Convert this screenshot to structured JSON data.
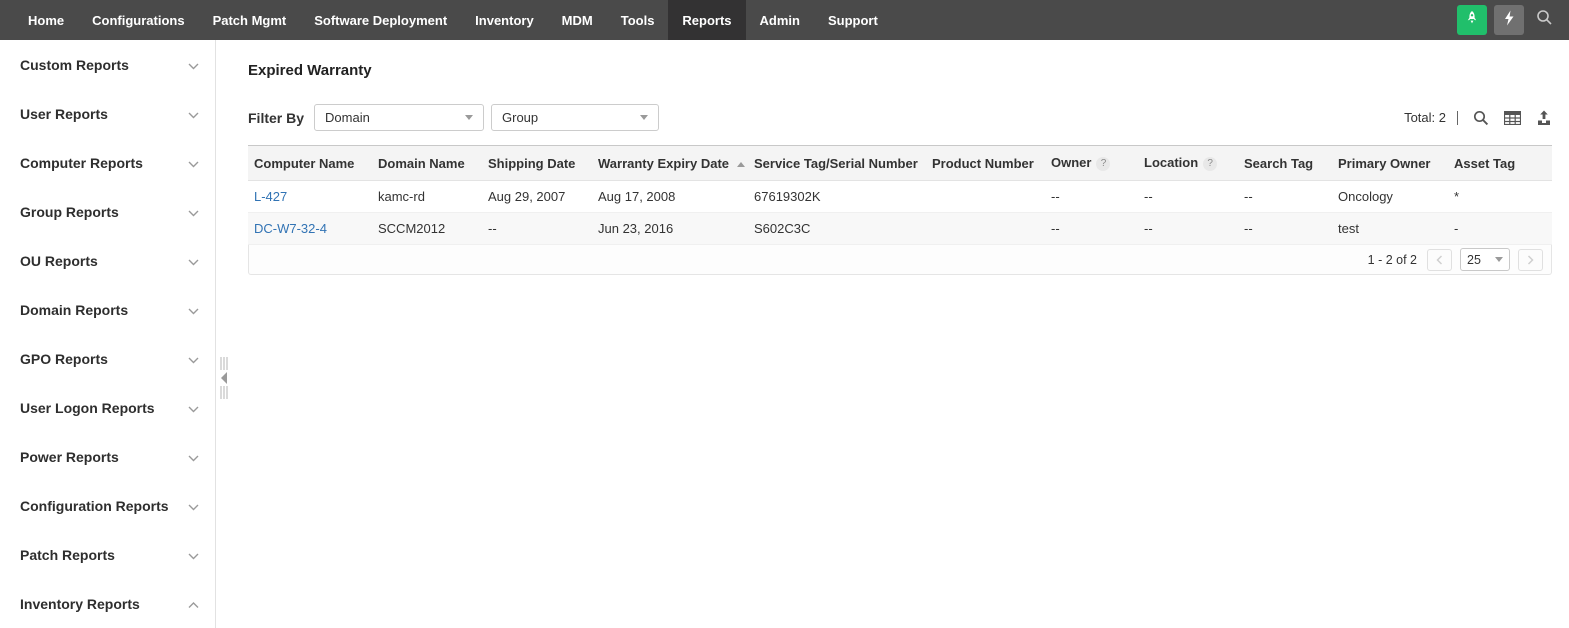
{
  "nav": {
    "items": [
      {
        "label": "Home",
        "active": false
      },
      {
        "label": "Configurations",
        "active": false
      },
      {
        "label": "Patch Mgmt",
        "active": false
      },
      {
        "label": "Software Deployment",
        "active": false
      },
      {
        "label": "Inventory",
        "active": false
      },
      {
        "label": "MDM",
        "active": false
      },
      {
        "label": "Tools",
        "active": false
      },
      {
        "label": "Reports",
        "active": true
      },
      {
        "label": "Admin",
        "active": false
      },
      {
        "label": "Support",
        "active": false
      }
    ]
  },
  "sidebar": {
    "items": [
      {
        "label": "Custom Reports",
        "expanded": false
      },
      {
        "label": "User Reports",
        "expanded": false
      },
      {
        "label": "Computer Reports",
        "expanded": false
      },
      {
        "label": "Group Reports",
        "expanded": false
      },
      {
        "label": "OU Reports",
        "expanded": false
      },
      {
        "label": "Domain Reports",
        "expanded": false
      },
      {
        "label": "GPO Reports",
        "expanded": false
      },
      {
        "label": "User Logon Reports",
        "expanded": false
      },
      {
        "label": "Power Reports",
        "expanded": false
      },
      {
        "label": "Configuration Reports",
        "expanded": false
      },
      {
        "label": "Patch Reports",
        "expanded": false
      },
      {
        "label": "Inventory Reports",
        "expanded": true
      }
    ]
  },
  "page": {
    "title": "Expired Warranty"
  },
  "filters": {
    "label": "Filter By",
    "domain_value": "Domain",
    "group_value": "Group"
  },
  "summary": {
    "total_label": "Total: 2"
  },
  "table": {
    "columns": [
      "Computer Name",
      "Domain Name",
      "Shipping Date",
      "Warranty Expiry Date",
      "Service Tag/Serial Number",
      "Product Number",
      "Owner",
      "Location",
      "Search Tag",
      "Primary Owner",
      "Asset Tag"
    ],
    "sort_column": "Warranty Expiry Date",
    "sort_direction": "asc",
    "help_mark": "?",
    "rows": [
      {
        "computer_name": "L-427",
        "domain_name": "kamc-rd",
        "shipping_date": "Aug 29, 2007",
        "warranty_expiry_date": "Aug 17, 2008",
        "service_tag": "67619302K",
        "product_number": "",
        "owner": "--",
        "location": "--",
        "search_tag": "--",
        "primary_owner": "Oncology",
        "asset_tag": "*"
      },
      {
        "computer_name": "DC-W7-32-4",
        "domain_name": "SCCM2012",
        "shipping_date": "--",
        "warranty_expiry_date": "Jun 23, 2016",
        "service_tag": "S602C3C",
        "product_number": "",
        "owner": "--",
        "location": "--",
        "search_tag": "--",
        "primary_owner": "test",
        "asset_tag": "-"
      }
    ]
  },
  "pagination": {
    "range": "1 - 2 of 2",
    "page_size": "25"
  },
  "colors": {
    "nav_bg": "#4a4a4a",
    "nav_active_bg": "#333233",
    "accent_green": "#21bf6b",
    "link_blue": "#3173b4",
    "header_bg": "#f4f4f4"
  }
}
